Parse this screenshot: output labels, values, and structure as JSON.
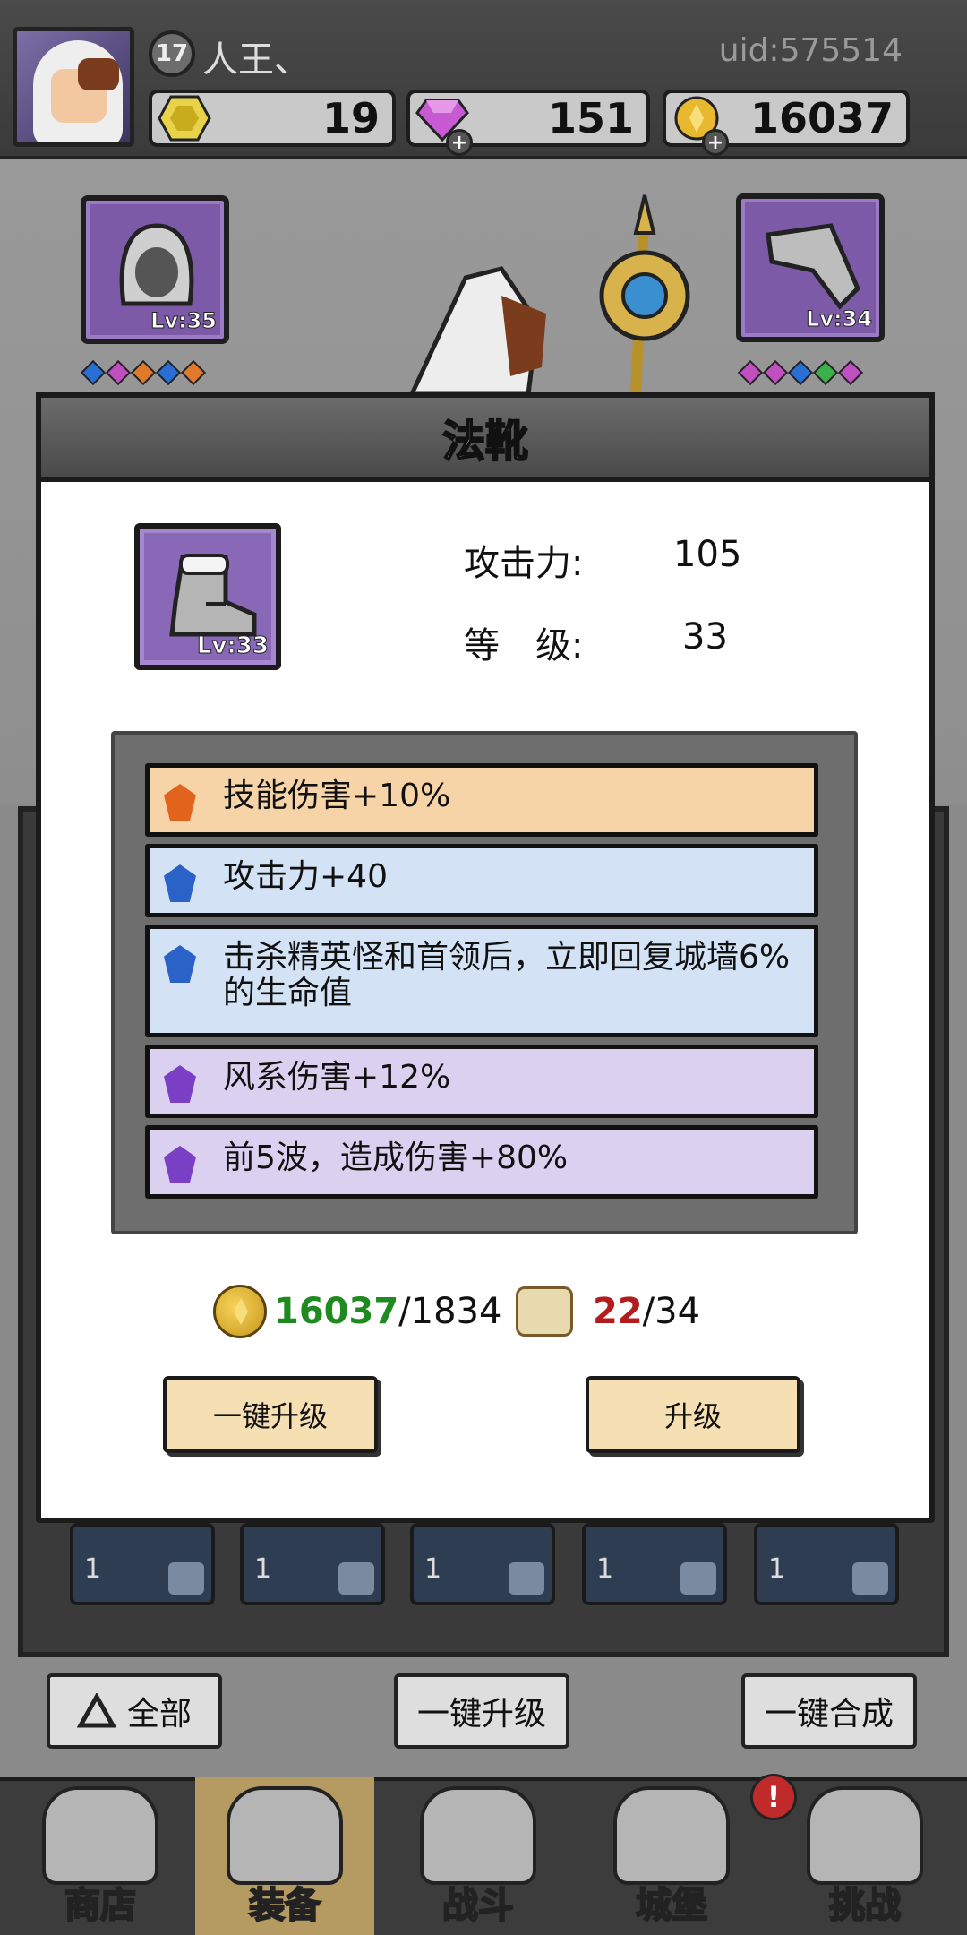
{
  "player": {
    "level": "17",
    "name": "人王、",
    "uid": "uid:575514"
  },
  "resources": [
    {
      "name": "hexagon-gem-icon",
      "value": "19",
      "color": "#e8d24a"
    },
    {
      "name": "diamond-icon",
      "value": "151",
      "color": "#c75ad4"
    },
    {
      "name": "gold-coin-icon",
      "value": "16037",
      "color": "#e8b830"
    }
  ],
  "equipped": {
    "left_slot_level": "Lv:35",
    "right_slot_level": "Lv:34",
    "left_gems": [
      "#2a6fd6",
      "#c04fc0",
      "#e07a2a",
      "#2a6fd6",
      "#e07a2a"
    ],
    "right_gems": [
      "#c04fc0",
      "#c04fc0",
      "#2a6fd6",
      "#3ab04a",
      "#c04fc0"
    ]
  },
  "modal": {
    "title": "法靴",
    "item_level": "Lv:33",
    "stats": [
      {
        "label": "攻击力:",
        "value": "105"
      },
      {
        "label": "等　级:",
        "value": "33"
      }
    ],
    "affixes": [
      {
        "text": "技能伤害+10%",
        "tier": "orange",
        "gem": "#e2641c",
        "bg": "#f7d3a8"
      },
      {
        "text": "攻击力+40",
        "tier": "blue",
        "gem": "#2a62c8",
        "bg": "#d4e2f5"
      },
      {
        "text": "击杀精英怪和首领后，立即回复城墙6%的生命值",
        "tier": "blue",
        "gem": "#2a62c8",
        "bg": "#d4e2f5"
      },
      {
        "text": "风系伤害+12%",
        "tier": "purple",
        "gem": "#7a3fc4",
        "bg": "#dcd0f0"
      },
      {
        "text": "前5波，造成伤害+80%",
        "tier": "purple",
        "gem": "#7a3fc4",
        "bg": "#dcd0f0"
      }
    ],
    "gold_have": "16037",
    "gold_need": "/1834",
    "scroll_have": "22",
    "scroll_need": "/34",
    "gold_have_color": "#1f8a1f",
    "scroll_have_color": "#b21c1c",
    "btn_auto_upgrade": "一键升级",
    "btn_upgrade": "升级"
  },
  "inventory": {
    "counts": [
      "1",
      "1",
      "1",
      "1",
      "1"
    ]
  },
  "bottom_buttons": {
    "all": "全部",
    "auto_upgrade": "一键升级",
    "auto_merge": "一键合成"
  },
  "nav": [
    "商店",
    "装备",
    "战斗",
    "城堡",
    "挑战"
  ],
  "nav_alert": "!"
}
